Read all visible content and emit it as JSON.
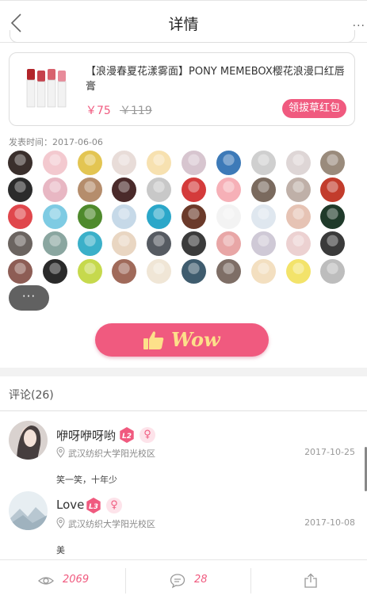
{
  "header": {
    "title": "详情",
    "back_icon": "chevron-left-icon",
    "more_label": "···"
  },
  "product": {
    "name": "【浪漫春夏花漾雾面】PONY MEMEBOX樱花浪漫口红唇膏",
    "price_now": "￥75",
    "price_old": "￥119",
    "coupon_label": "领拔草红包"
  },
  "publish_time": "发表时间：2017-06-06",
  "more_avatars_label": "···",
  "wow_label": "Wow",
  "comments": {
    "title": "评论(26)",
    "items": [
      {
        "name": "咿呀咿呀哟",
        "level": "L2",
        "gender": "♀",
        "location": "武汉纺织大学阳光校区",
        "date": "2017-10-25",
        "text": "笑一笑，十年少"
      },
      {
        "name": "Love",
        "level": "L3",
        "gender": "♀",
        "location": "武汉纺织大学阳光校区",
        "date": "2017-10-08",
        "text": "美"
      }
    ]
  },
  "footer": {
    "views": "2069",
    "comments": "28",
    "share_icon": "share-icon"
  },
  "colors": {
    "accent": "#f05a7f",
    "wow_text": "#fde08a",
    "dark_pill": "#616161"
  }
}
